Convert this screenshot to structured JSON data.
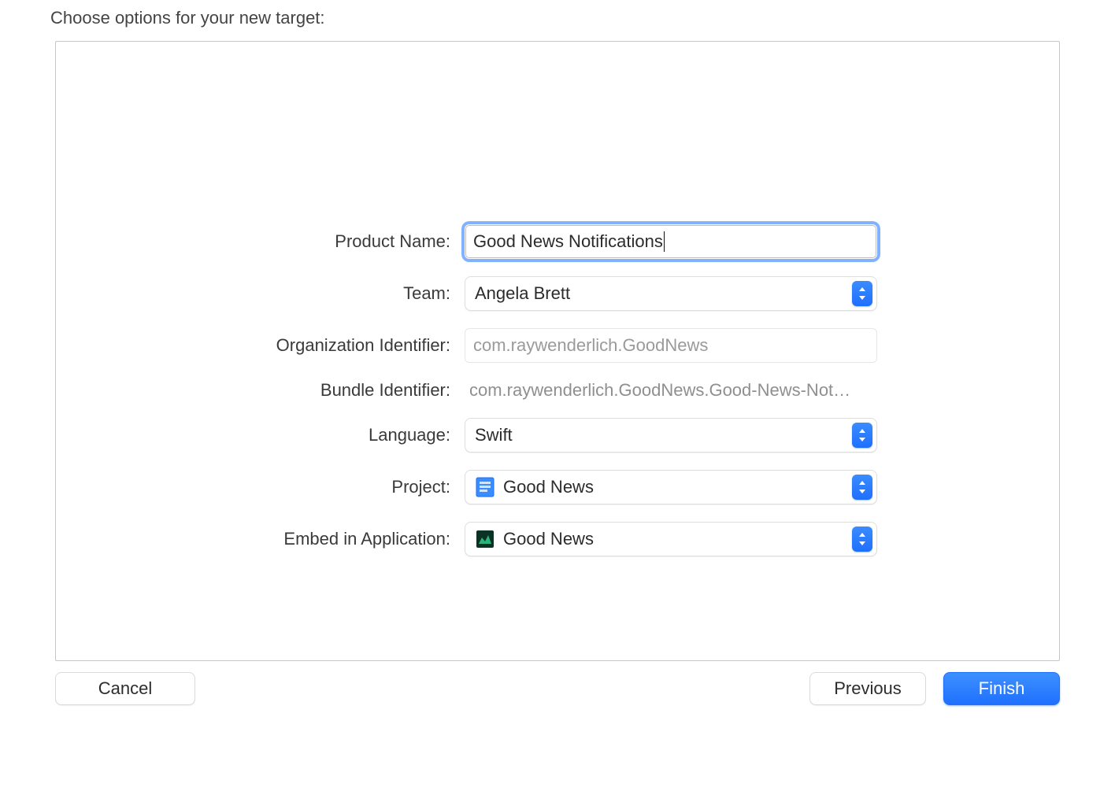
{
  "header": {
    "title": "Choose options for your new target:"
  },
  "form": {
    "product_name": {
      "label": "Product Name:",
      "value": "Good News Notifications"
    },
    "team": {
      "label": "Team:",
      "value": "Angela Brett"
    },
    "org_id": {
      "label": "Organization Identifier:",
      "value": "com.raywenderlich.GoodNews"
    },
    "bundle_id": {
      "label": "Bundle Identifier:",
      "value": "com.raywenderlich.GoodNews.Good-News-Not…"
    },
    "language": {
      "label": "Language:",
      "value": "Swift"
    },
    "project": {
      "label": "Project:",
      "value": "Good News"
    },
    "embed": {
      "label": "Embed in Application:",
      "value": "Good News"
    }
  },
  "buttons": {
    "cancel": "Cancel",
    "previous": "Previous",
    "finish": "Finish"
  },
  "icons": {
    "xcodeproj_color": "#2e8cff",
    "app_icon_bg": "#0b3325",
    "app_icon_fg": "#2db37a"
  }
}
